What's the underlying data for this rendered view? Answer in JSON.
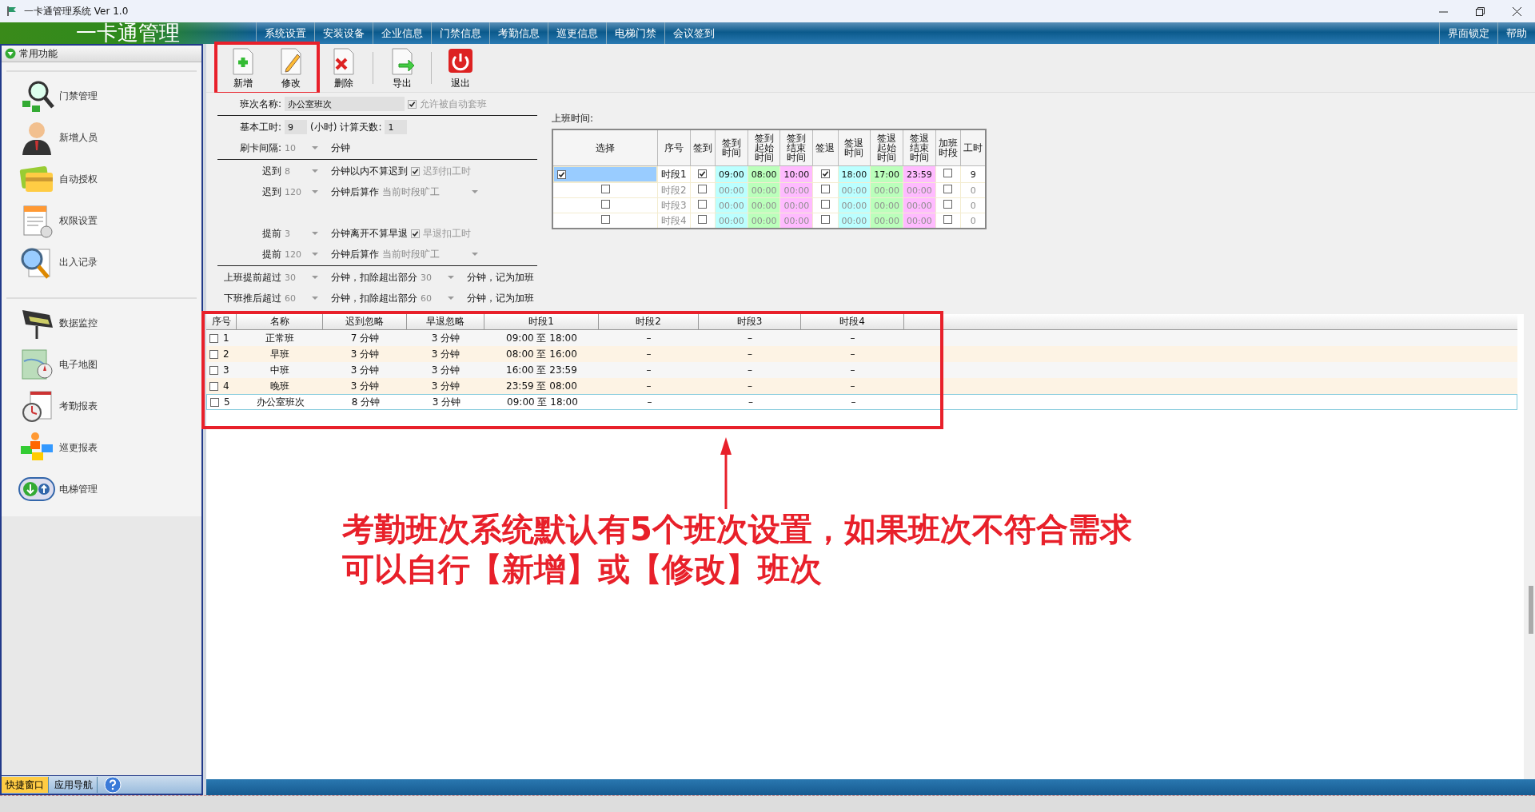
{
  "window": {
    "title": "一卡通管理系统  Ver 1.0"
  },
  "app_title": "一卡通管理",
  "menu": [
    "系统设置",
    "安装设备",
    "企业信息",
    "门禁信息",
    "考勤信息",
    "巡更信息",
    "电梯门禁",
    "会议签到"
  ],
  "menu_right": [
    "界面锁定",
    "帮助"
  ],
  "sidebar": {
    "header": "常用功能",
    "groups": [
      [
        "门禁管理",
        "新增人员",
        "自动授权",
        "权限设置",
        "出入记录"
      ],
      [
        "数据监控",
        "电子地图",
        "考勤报表",
        "巡更报表",
        "电梯管理"
      ]
    ],
    "tabs": [
      {
        "label": "快捷窗口",
        "selected": true
      },
      {
        "label": "应用导航",
        "selected": false
      }
    ]
  },
  "toolbar": [
    {
      "label": "新增",
      "kind": "add",
      "highlighted": true
    },
    {
      "label": "修改",
      "kind": "edit",
      "highlighted": true
    },
    {
      "label": "删除",
      "kind": "delete",
      "highlighted": false
    },
    {
      "label": "导出",
      "kind": "export",
      "highlighted": false
    },
    {
      "label": "退出",
      "kind": "exit",
      "highlighted": false
    }
  ],
  "form": {
    "sections": [
      {
        "divider": false,
        "rows": [
          [
            {
              "kind": "label",
              "text": "班次名称:"
            },
            {
              "kind": "input_wide",
              "value": "办公室班次"
            },
            {
              "kind": "check",
              "label": "允许被自动套班",
              "checked": true,
              "disabled": true
            }
          ]
        ]
      },
      {
        "divider": true,
        "rows": [
          [
            {
              "kind": "label",
              "text": "基本工时:"
            },
            {
              "kind": "input",
              "value": "9"
            },
            {
              "kind": "text",
              "text": "(小时)"
            },
            {
              "kind": "text",
              "text": "计算天数:"
            },
            {
              "kind": "input",
              "value": "1"
            }
          ],
          [
            {
              "kind": "label",
              "text": "刷卡间隔:"
            },
            {
              "kind": "spin",
              "value": "10",
              "disabled": true
            },
            {
              "kind": "text",
              "text": "分钟"
            }
          ]
        ]
      },
      {
        "divider": true,
        "rows": [
          [
            {
              "kind": "label",
              "text": "迟到"
            },
            {
              "kind": "spin",
              "value": "8",
              "disabled": true
            },
            {
              "kind": "text",
              "text": "分钟以内不算迟到"
            },
            {
              "kind": "check",
              "label": "迟到扣工时",
              "checked": true,
              "disabled": true
            }
          ],
          [
            {
              "kind": "label",
              "text": "迟到"
            },
            {
              "kind": "spin",
              "value": "120",
              "disabled": true
            },
            {
              "kind": "text",
              "text": "分钟后算作"
            },
            {
              "kind": "select",
              "value": "当前时段旷工"
            }
          ]
        ]
      },
      {
        "divider": false,
        "rows": [
          [
            {
              "kind": "label",
              "text": "提前"
            },
            {
              "kind": "spin",
              "value": "3",
              "disabled": true
            },
            {
              "kind": "text",
              "text": "分钟离开不算早退"
            },
            {
              "kind": "check",
              "label": "早退扣工时",
              "checked": true,
              "disabled": true
            }
          ],
          [
            {
              "kind": "label",
              "text": "提前"
            },
            {
              "kind": "spin",
              "value": "120",
              "disabled": true
            },
            {
              "kind": "text",
              "text": "分钟后算作"
            },
            {
              "kind": "select",
              "value": "当前时段旷工"
            }
          ]
        ]
      },
      {
        "divider": true,
        "rows": [
          [
            {
              "kind": "label",
              "text": "上班提前超过"
            },
            {
              "kind": "spin",
              "value": "30",
              "disabled": true
            },
            {
              "kind": "text",
              "text": "分钟，扣除超出部分"
            },
            {
              "kind": "spin",
              "value": "30",
              "disabled": true
            },
            {
              "kind": "text",
              "text": "分钟，记为加班"
            }
          ],
          [
            {
              "kind": "label",
              "text": "下班推后超过"
            },
            {
              "kind": "spin",
              "value": "60",
              "disabled": true
            },
            {
              "kind": "text",
              "text": "分钟，扣除超出部分"
            },
            {
              "kind": "spin",
              "value": "60",
              "disabled": true
            },
            {
              "kind": "text",
              "text": "分钟，记为加班"
            }
          ]
        ]
      }
    ]
  },
  "timing": {
    "title": "上班时间:",
    "columns": [
      "选择",
      "序号",
      "签到",
      "签到时间",
      "签到起始时间",
      "签到结束时间",
      "签退",
      "签退时间",
      "签退起始时间",
      "签退结束时间",
      "加班时段",
      "工时"
    ],
    "rows": [
      {
        "selected": true,
        "period": "时段1",
        "active": true,
        "sign_in": true,
        "in": "09:00",
        "in_start": "08:00",
        "in_end": "10:00",
        "sign_out": true,
        "out": "18:00",
        "out_start": "17:00",
        "out_end": "23:59",
        "overtime": false,
        "hours": "9"
      },
      {
        "selected": false,
        "period": "时段2",
        "active": false,
        "sign_in": false,
        "in": "00:00",
        "in_start": "00:00",
        "in_end": "00:00",
        "sign_out": false,
        "out": "00:00",
        "out_start": "00:00",
        "out_end": "00:00",
        "overtime": false,
        "hours": "0"
      },
      {
        "selected": false,
        "period": "时段3",
        "active": false,
        "sign_in": false,
        "in": "00:00",
        "in_start": "00:00",
        "in_end": "00:00",
        "sign_out": false,
        "out": "00:00",
        "out_start": "00:00",
        "out_end": "00:00",
        "overtime": false,
        "hours": "0"
      },
      {
        "selected": false,
        "period": "时段4",
        "active": false,
        "sign_in": false,
        "in": "00:00",
        "in_start": "00:00",
        "in_end": "00:00",
        "sign_out": false,
        "out": "00:00",
        "out_start": "00:00",
        "out_end": "00:00",
        "overtime": false,
        "hours": "0"
      }
    ]
  },
  "shift_list": {
    "highlighted": true,
    "columns": [
      "序号",
      "名称",
      "迟到忽略",
      "早退忽略",
      "时段1",
      "时段2",
      "时段3",
      "时段4"
    ],
    "rows": [
      {
        "checked": false,
        "selected": false,
        "cells": [
          "1",
          "正常班",
          "7 分钟",
          "3 分钟",
          "09:00 至 18:00",
          "–",
          "–",
          "–"
        ]
      },
      {
        "checked": false,
        "selected": false,
        "cells": [
          "2",
          "早班",
          "3 分钟",
          "3 分钟",
          "08:00 至 16:00",
          "–",
          "–",
          "–"
        ]
      },
      {
        "checked": false,
        "selected": false,
        "cells": [
          "3",
          "中班",
          "3 分钟",
          "3 分钟",
          "16:00 至 23:59",
          "–",
          "–",
          "–"
        ]
      },
      {
        "checked": false,
        "selected": false,
        "cells": [
          "4",
          "晚班",
          "3 分钟",
          "3 分钟",
          "23:59 至 08:00",
          "–",
          "–",
          "–"
        ]
      },
      {
        "checked": false,
        "selected": true,
        "cells": [
          "5",
          "办公室班次",
          "8 分钟",
          "3 分钟",
          "09:00 至 18:00",
          "–",
          "–",
          "–"
        ]
      }
    ]
  },
  "annotation": {
    "lines": [
      "考勤班次系统默认有5个班次设置，如果班次不符合需求",
      "可以自行【新增】或【修改】班次"
    ]
  }
}
